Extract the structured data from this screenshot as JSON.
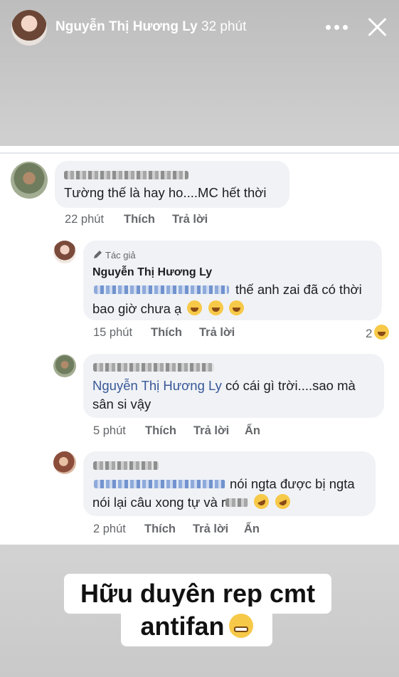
{
  "story": {
    "author_name": "Nguyễn Thị Hương Ly",
    "time": "32 phút",
    "caption_line1": "Hữu duyên rep cmt",
    "caption_line2": "antifan"
  },
  "comments": [
    {
      "text": "Tường thế là hay ho....MC hết thời",
      "time": "22 phút",
      "like": "Thích",
      "reply": "Trả lời"
    },
    {
      "author_tag": "Tác giả",
      "author": "Nguyễn Thị Hương Ly",
      "text_1": "thế anh zai đã có thời",
      "text_2": "bao giờ chưa ạ",
      "time": "15 phút",
      "like": "Thích",
      "reply": "Trả lời",
      "reaction_count": "2"
    },
    {
      "mention": "Nguyễn Thị Hương Ly",
      "text_1": "có cái gì trời....sao mà",
      "text_2": "sân si vậy",
      "time": "5 phút",
      "like": "Thích",
      "reply": "Trả lời",
      "hide": "Ẩn"
    },
    {
      "text_1": "nói ngta được bị ngta",
      "text_2a": "nói lại câu xong tự và r",
      "time": "2 phút",
      "like": "Thích",
      "reply": "Trả lời",
      "hide": "Ẩn"
    }
  ],
  "icons": [
    "more-icon",
    "close-icon",
    "pencil-icon",
    "grinning-emoji",
    "rofl-emoji",
    "grimace-emoji"
  ]
}
